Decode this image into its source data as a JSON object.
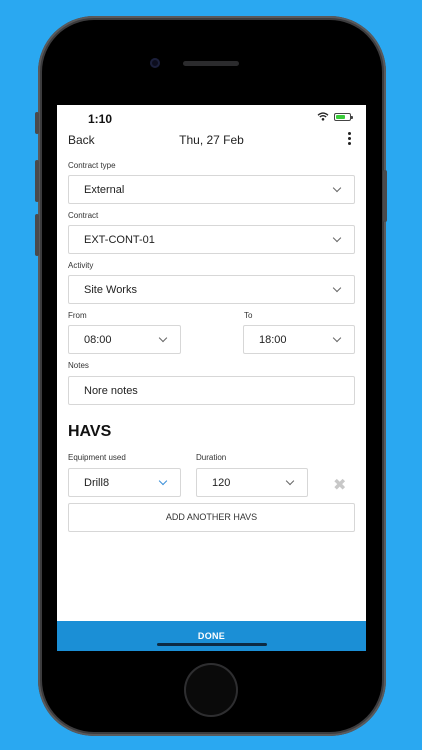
{
  "status_bar": {
    "time": "1:10"
  },
  "nav": {
    "back": "Back",
    "title": "Thu, 27 Feb"
  },
  "form": {
    "contract_type": {
      "label": "Contract type",
      "value": "External"
    },
    "contract": {
      "label": "Contract",
      "value": "EXT-CONT-01"
    },
    "activity": {
      "label": "Activity",
      "value": "Site Works"
    },
    "from": {
      "label": "From",
      "value": "08:00"
    },
    "to": {
      "label": "To",
      "value": "18:00"
    },
    "notes": {
      "label": "Notes",
      "value": "Nore notes"
    }
  },
  "havs": {
    "title": "HAVS",
    "equipment": {
      "label": "Equipment used",
      "value": "Drill8"
    },
    "duration": {
      "label": "Duration",
      "value": "120"
    },
    "remove_icon": "close-icon",
    "add_label": "ADD ANOTHER HAVS"
  },
  "footer": {
    "done_label": "DONE"
  },
  "colors": {
    "background": "#2aa8f1",
    "accent": "#1b8fd6",
    "battery": "#3bcc3b"
  }
}
